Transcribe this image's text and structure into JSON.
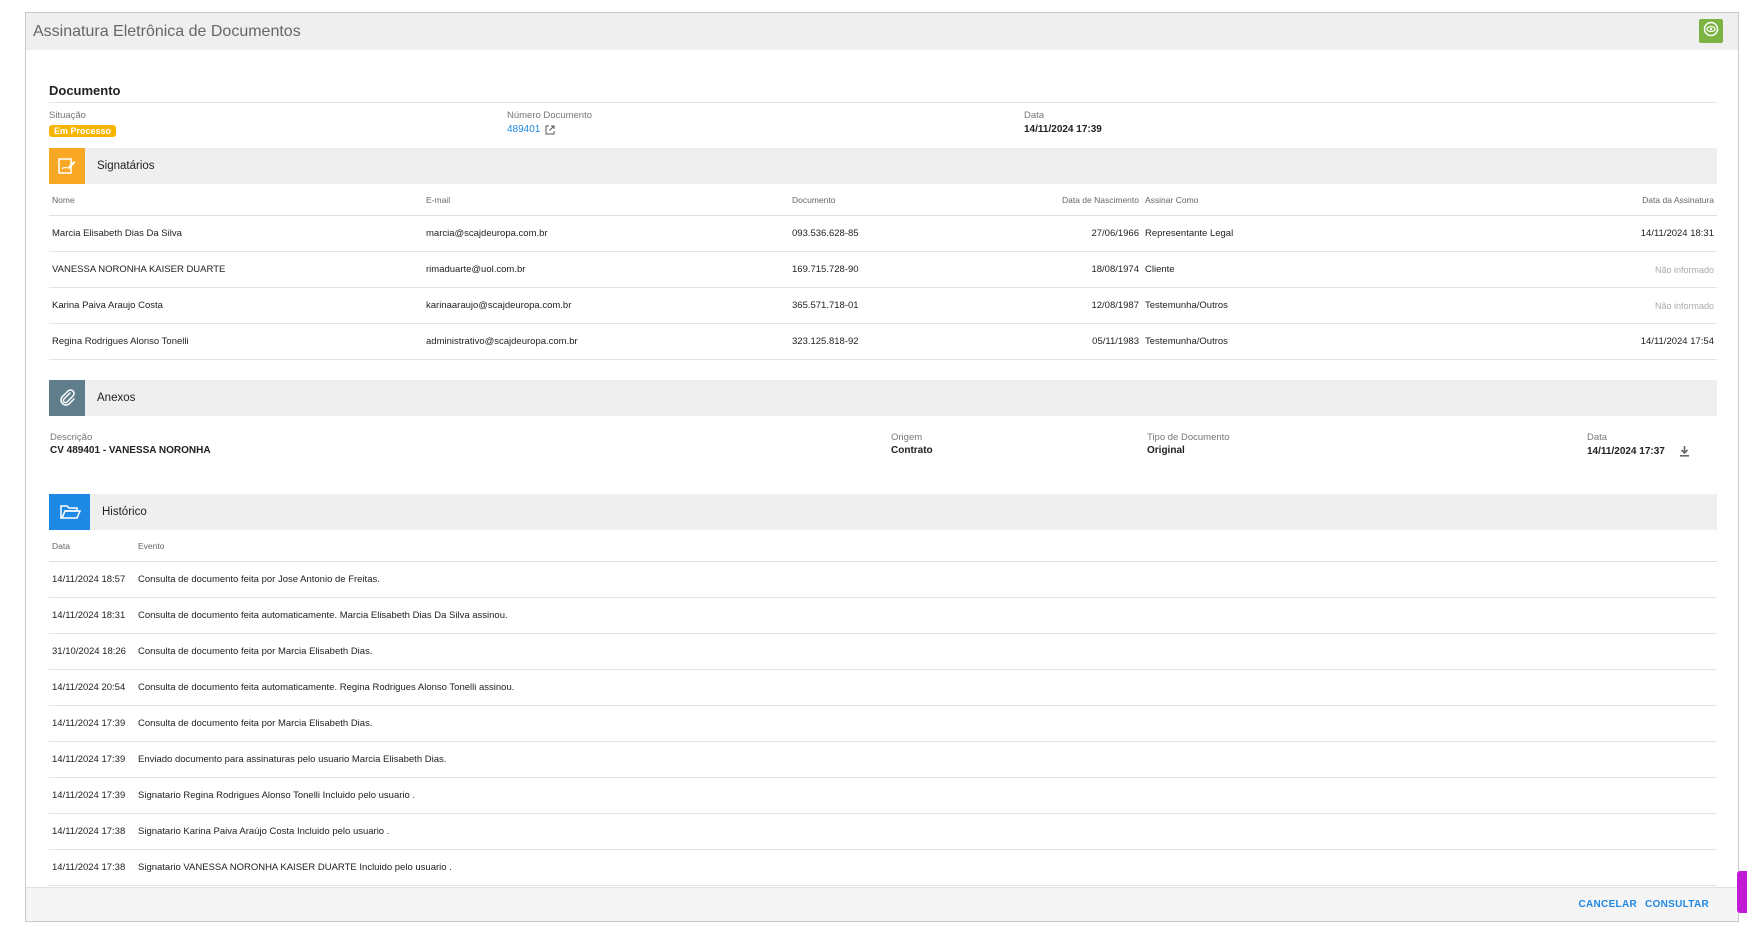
{
  "window": {
    "title": "Assinatura Eletrônica de Documentos"
  },
  "document": {
    "heading": "Documento",
    "situacao_label": "Situação",
    "situacao_value": "Em Processo",
    "numero_label": "Número Documento",
    "numero_value": "489401",
    "data_label": "Data",
    "data_value": "14/11/2024 17:39"
  },
  "signatarios": {
    "title": "Signatários",
    "headers": {
      "nome": "Nome",
      "email": "E-mail",
      "documento": "Documento",
      "nascimento": "Data de Nascimento",
      "assinar_como": "Assinar Como",
      "data_assinatura": "Data da Assinatura"
    },
    "rows": [
      {
        "nome": "Marcia Elisabeth Dias Da Silva",
        "email": "marcia@scajdeuropa.com.br",
        "documento": "093.536.628-85",
        "nascimento": "27/06/1966",
        "assinar_como": "Representante Legal",
        "data_assinatura": "14/11/2024 18:31"
      },
      {
        "nome": "VANESSA NORONHA KAISER DUARTE",
        "email": "rimaduarte@uol.com.br",
        "documento": "169.715.728-90",
        "nascimento": "18/08/1974",
        "assinar_como": "Cliente",
        "data_assinatura": "Não informado"
      },
      {
        "nome": "Karina Paiva Araujo Costa",
        "email": "karinaaraujo@scajdeuropa.com.br",
        "documento": "365.571.718-01",
        "nascimento": "12/08/1987",
        "assinar_como": "Testemunha/Outros",
        "data_assinatura": "Não informado"
      },
      {
        "nome": "Regina Rodrigues Alonso Tonelli",
        "email": "administrativo@scajdeuropa.com.br",
        "documento": "323.125.818-92",
        "nascimento": "05/11/1983",
        "assinar_como": "Testemunha/Outros",
        "data_assinatura": "14/11/2024 17:54"
      }
    ]
  },
  "anexos": {
    "title": "Anexos",
    "descricao_label": "Descrição",
    "descricao_value": "CV 489401 - VANESSA NORONHA",
    "origem_label": "Origem",
    "origem_value": "Contrato",
    "tipo_label": "Tipo de Documento",
    "tipo_value": "Original",
    "data_label": "Data",
    "data_value": "14/11/2024 17:37"
  },
  "historico": {
    "title": "Histórico",
    "headers": {
      "data": "Data",
      "evento": "Evento"
    },
    "rows": [
      {
        "data": "14/11/2024 18:57",
        "evento": "Consulta de documento feita por Jose Antonio de Freitas."
      },
      {
        "data": "14/11/2024 18:31",
        "evento": "Consulta de documento feita automaticamente. Marcia Elisabeth Dias Da Silva assinou."
      },
      {
        "data": "31/10/2024 18:26",
        "evento": "Consulta de documento feita por Marcia Elisabeth Dias."
      },
      {
        "data": "14/11/2024 20:54",
        "evento": "Consulta de documento feita automaticamente. Regina Rodrigues Alonso Tonelli assinou."
      },
      {
        "data": "14/11/2024 17:39",
        "evento": "Consulta de documento feita por Marcia Elisabeth Dias."
      },
      {
        "data": "14/11/2024 17:39",
        "evento": "Enviado documento para assinaturas pelo usuario Marcia Elisabeth Dias."
      },
      {
        "data": "14/11/2024 17:39",
        "evento": "Signatario Regina Rodrigues Alonso Tonelli Incluido pelo usuario ."
      },
      {
        "data": "14/11/2024 17:38",
        "evento": "Signatario Karina Paiva Araújo Costa Incluido pelo usuario ."
      },
      {
        "data": "14/11/2024 17:38",
        "evento": "Signatario VANESSA NORONHA KAISER DUARTE Incluido pelo usuario ."
      }
    ]
  },
  "footer": {
    "cancel_label": "CANCELAR",
    "consult_label": "CONSULTAR"
  },
  "colors": {
    "accent": "#1e88e5",
    "badge": "#f8b500",
    "eye": "#7cb342",
    "signatarios_icon": "#f9a825",
    "anexos_icon": "#607d8b",
    "historico_icon": "#1e88e5"
  },
  "icons": {
    "view": "eye-icon",
    "signatarios": "signature-icon",
    "anexos": "paperclip-icon",
    "historico": "folder-open-icon",
    "download": "download-icon",
    "external": "external-link-icon"
  }
}
